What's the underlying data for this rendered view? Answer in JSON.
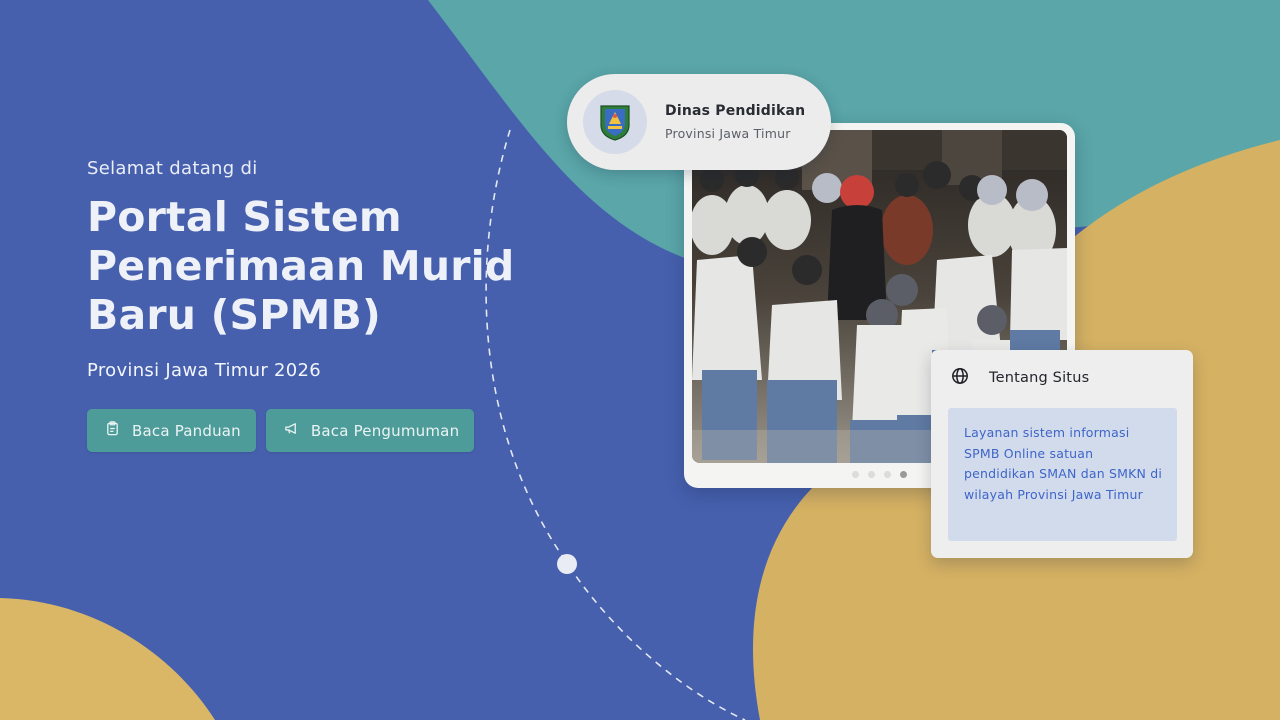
{
  "hero": {
    "welcome": "Selamat datang di",
    "title_line1": "Portal Sistem",
    "title_line2": "Penerimaan Murid",
    "title_line3": "Baru (SPMB)",
    "subtitle": "Provinsi Jawa Timur 2026"
  },
  "actions": {
    "guide_label": "Baca Panduan",
    "guide_icon": "clipboard-icon",
    "announcement_label": "Baca Pengumuman",
    "announcement_icon": "megaphone-icon"
  },
  "agency": {
    "name": "Dinas Pendidikan",
    "region": "Provinsi Jawa Timur",
    "icon": "east-java-emblem"
  },
  "carousel": {
    "slide_count": 4,
    "active_slide": 4
  },
  "about": {
    "title": "Tentang Situs",
    "icon": "globe-icon",
    "description": "Layanan sistem informasi SPMB Online satuan pendidikan SMAN dan SMKN di wilayah Provinsi Jawa Timur"
  },
  "colors": {
    "blue": "#4660ae",
    "teal": "#5aa6a8",
    "gold": "#d5b163",
    "button": "#4e9c9a",
    "link_text": "#3e66c9"
  }
}
